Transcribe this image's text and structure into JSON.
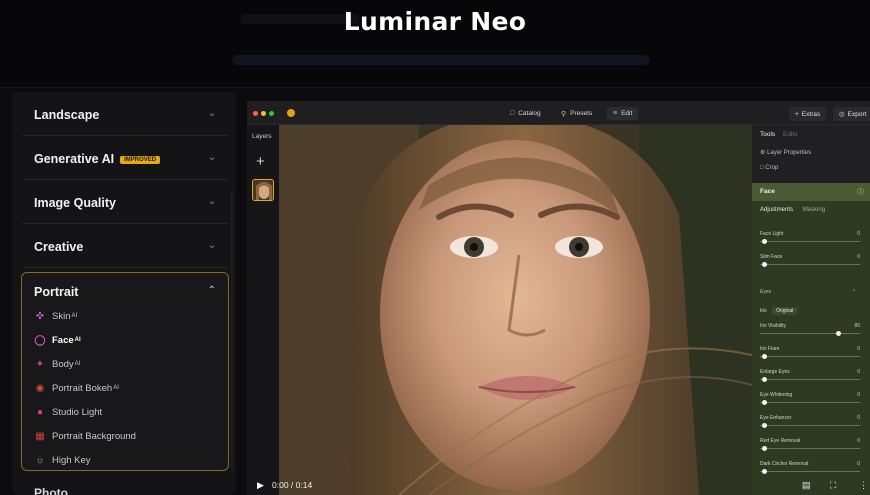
{
  "header": {
    "brand": "Luminar Neo"
  },
  "categories": [
    {
      "label": "Landscape",
      "chevron": "chevron-down-icon",
      "badge": ""
    },
    {
      "label": "Generative AI",
      "chevron": "chevron-down-icon",
      "badge": "IMPROVED"
    },
    {
      "label": "Image Quality",
      "chevron": "chevron-down-icon",
      "badge": ""
    },
    {
      "label": "Creative",
      "chevron": "chevron-down-icon",
      "badge": ""
    }
  ],
  "portrait": {
    "label": "Portrait",
    "chevron": "chevron-up-icon",
    "tools": [
      {
        "label": "Skin",
        "ai": "AI",
        "icon": "skin-icon",
        "active": false
      },
      {
        "label": "Face",
        "ai": "AI",
        "icon": "face-icon",
        "active": true
      },
      {
        "label": "Body",
        "ai": "AI",
        "icon": "body-icon",
        "active": false
      },
      {
        "label": "Portrait Bokeh",
        "ai": "AI",
        "icon": "bokeh-icon",
        "active": false
      },
      {
        "label": "Studio Light",
        "ai": "",
        "icon": "studio-light-icon",
        "active": false
      },
      {
        "label": "Portrait Background",
        "ai": "",
        "icon": "background-icon",
        "active": false
      },
      {
        "label": "High Key",
        "ai": "",
        "icon": "high-key-icon",
        "active": false
      }
    ]
  },
  "next_category": "Photo...",
  "app": {
    "nav": {
      "catalog": "Catalog",
      "presets": "Presets",
      "edit": "Edit"
    },
    "extras": "Extras",
    "export": "Export",
    "layers": {
      "title": "Layers"
    },
    "tools_panel": {
      "tools_tab": "Tools",
      "edits_tab": "Edits",
      "layer_properties": "Layer Properties",
      "crop": "Crop",
      "face_title": "Face",
      "adjustments_tab": "Adjustments",
      "masking_tab": "Masking",
      "sliders_top": [
        {
          "label": "Face Light",
          "value": "0",
          "pos": 0.02
        },
        {
          "label": "Slim Face",
          "value": "0",
          "pos": 0.02
        }
      ],
      "eyes_section": "Eyes",
      "iris_label": "Iris",
      "iris_value": "Original",
      "sliders_eyes": [
        {
          "label": "Iris Visibility",
          "value": "80",
          "pos": 0.8
        },
        {
          "label": "Iris Flare",
          "value": "0",
          "pos": 0.02
        },
        {
          "label": "Enlarge Eyes",
          "value": "0",
          "pos": 0.02
        },
        {
          "label": "Eye Whitening",
          "value": "0",
          "pos": 0.02
        },
        {
          "label": "Eye Enhancer",
          "value": "0",
          "pos": 0.02
        },
        {
          "label": "Red Eye Removal",
          "value": "0",
          "pos": 0.02
        },
        {
          "label": "Dark Circles Removal",
          "value": "0",
          "pos": 0.02
        }
      ]
    }
  },
  "video": {
    "time": "0:00 / 0:14"
  },
  "colors": {
    "accent": "#e5a915",
    "face_panel": "#2f3a22"
  }
}
